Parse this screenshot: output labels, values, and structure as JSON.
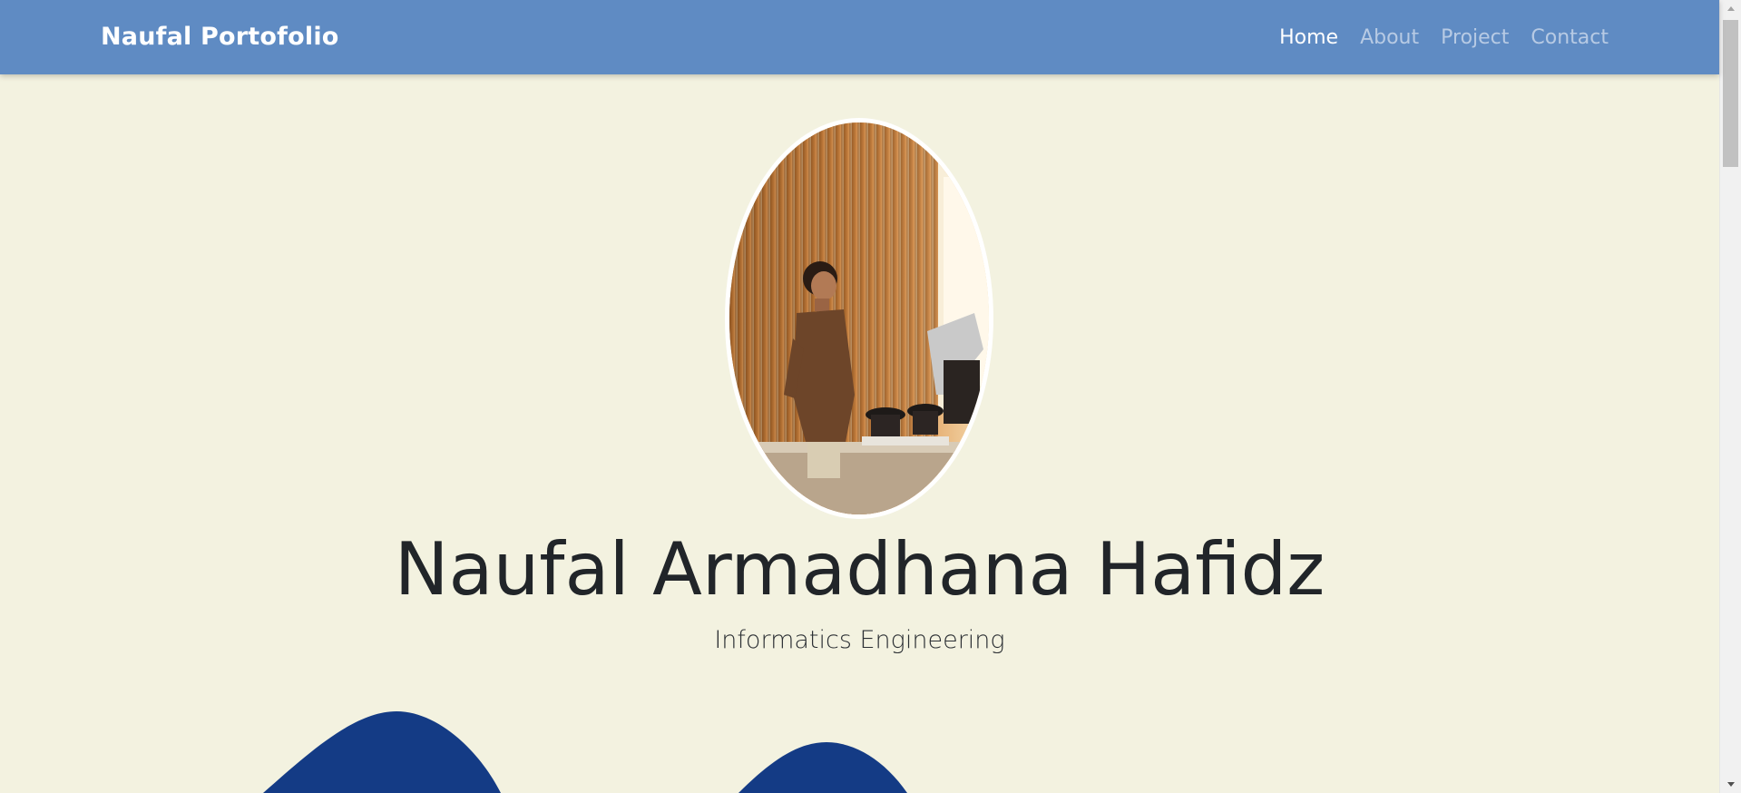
{
  "navbar": {
    "brand": "Naufal Portofolio",
    "links": [
      {
        "label": "Home",
        "active": true
      },
      {
        "label": "About",
        "active": false
      },
      {
        "label": "Project",
        "active": false
      },
      {
        "label": "Contact",
        "active": false
      }
    ]
  },
  "hero": {
    "name": "Naufal Armadhana Hafidz",
    "subtitle": "Informatics Engineering"
  },
  "colors": {
    "navbar_bg": "#5f8bc3",
    "page_bg": "#f3f2e0",
    "wave": "#143b85",
    "text": "#212529"
  },
  "icons": {
    "scroll_up": "scroll-up-arrow-icon",
    "scroll_down": "scroll-down-arrow-icon"
  }
}
